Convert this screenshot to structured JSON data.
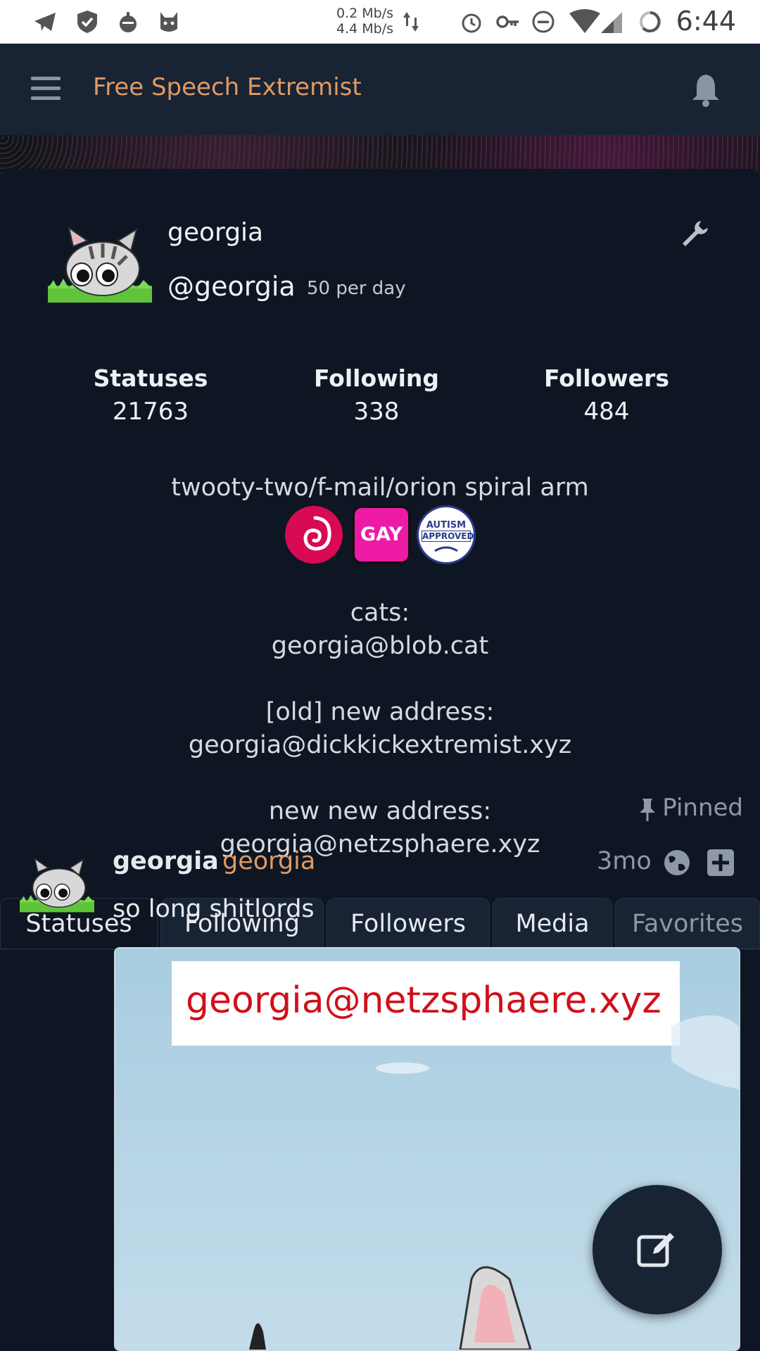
{
  "statusbar": {
    "speed_up": "0.2 Mb/s",
    "speed_down": "4.4 Mb/s",
    "time": "6:44"
  },
  "appbar": {
    "title": "Free Speech Extremist"
  },
  "profile": {
    "display_name": "georgia",
    "handle": "@georgia",
    "rate": "50 per day",
    "stats": [
      {
        "label": "Statuses",
        "value": "21763"
      },
      {
        "label": "Following",
        "value": "338"
      },
      {
        "label": "Followers",
        "value": "484"
      }
    ],
    "bio_line": "twooty-two/f-mail/orion spiral arm",
    "emoji_gay_label": "GAY",
    "emoji_autism_label_1": "AUTISM",
    "emoji_autism_label_2": "APPROVED",
    "bio_cats_label": "cats:",
    "bio_cats_addr": "georgia@blob.cat",
    "bio_old_label": "[old] new address:",
    "bio_old_addr": "georgia@dickkickextremist.xyz",
    "bio_new_label": "new new address:",
    "bio_new_addr": "georgia@netzsphaere.xyz"
  },
  "tabs": [
    "Statuses",
    "Following",
    "Followers",
    "Media",
    "Favorites"
  ],
  "post": {
    "pinned_label": "Pinned",
    "author_name": "georgia",
    "author_handle": "georgia",
    "time": "3mo",
    "text": "so long shitlords",
    "image_text": "georgia@netzsphaere.xyz"
  },
  "colors": {
    "accent": "#e09a62",
    "background": "#0f1623",
    "panel": "#182334"
  }
}
